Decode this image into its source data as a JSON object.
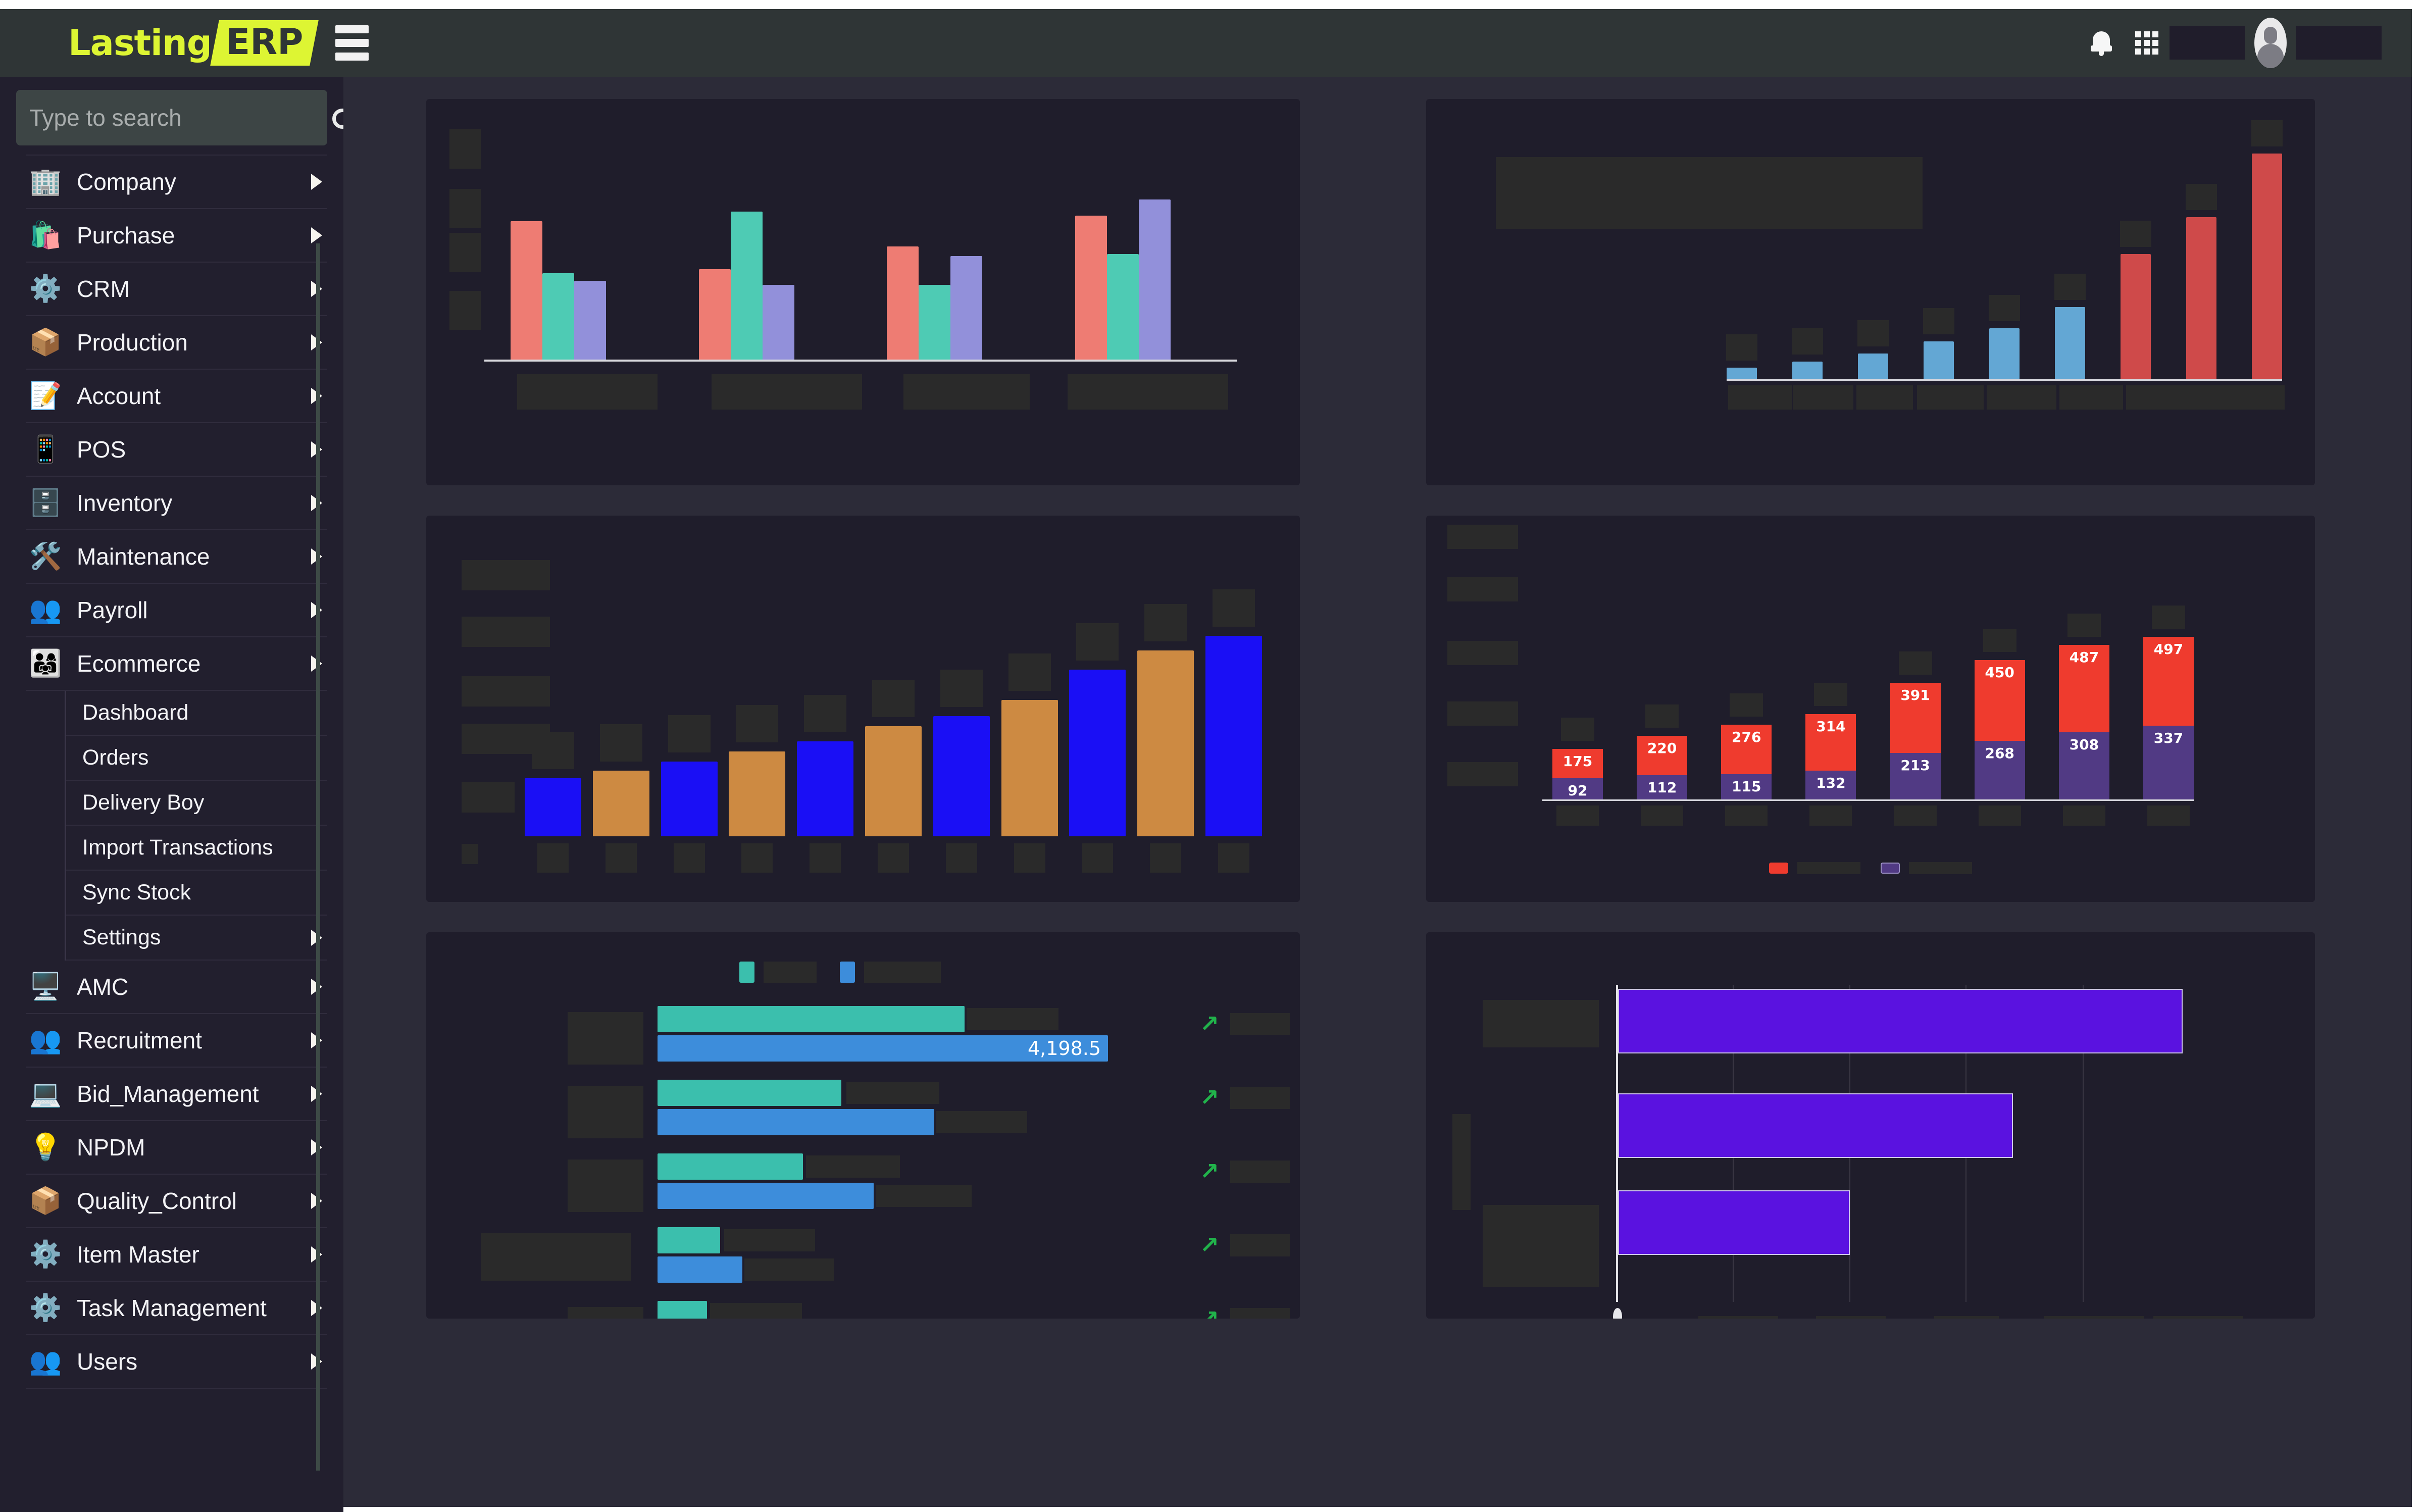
{
  "header": {
    "logo_primary": "Lasting",
    "logo_badge": "ERP",
    "icons": {
      "menu": "hamburger-icon",
      "notifications": "bell-icon",
      "apps": "grid-icon",
      "avatar": "user-avatar"
    }
  },
  "sidebar": {
    "search": {
      "placeholder": "Type to search",
      "value": "",
      "icon": "search-icon"
    },
    "items": [
      {
        "label": "Company",
        "icon": "🏢",
        "expandable": true
      },
      {
        "label": "Purchase",
        "icon": "🛍️",
        "expandable": true
      },
      {
        "label": "CRM",
        "icon": "⚙️",
        "expandable": true
      },
      {
        "label": "Production",
        "icon": "📦",
        "expandable": true
      },
      {
        "label": "Account",
        "icon": "📝",
        "expandable": true
      },
      {
        "label": "POS",
        "icon": "📱",
        "expandable": true
      },
      {
        "label": "Inventory",
        "icon": "🗄️",
        "expandable": true
      },
      {
        "label": "Maintenance",
        "icon": "🛠️",
        "expandable": true
      },
      {
        "label": "Payroll",
        "icon": "👥",
        "expandable": true
      },
      {
        "label": "Ecommerce",
        "icon": "👨‍👩‍👧",
        "expandable": true,
        "expanded": true
      }
    ],
    "ecommerce_submenu": [
      {
        "label": "Dashboard",
        "expandable": false
      },
      {
        "label": "Orders",
        "expandable": false
      },
      {
        "label": "Delivery Boy",
        "expandable": false
      },
      {
        "label": "Import Transactions",
        "expandable": false
      },
      {
        "label": "Sync Stock",
        "expandable": false
      },
      {
        "label": "Settings",
        "expandable": true
      }
    ],
    "items_after": [
      {
        "label": "AMC",
        "icon": "🖥️",
        "expandable": true
      },
      {
        "label": "Recruitment",
        "icon": "👥",
        "expandable": true
      },
      {
        "label": "Bid_Management",
        "icon": "💻",
        "expandable": true
      },
      {
        "label": "NPDM",
        "icon": "💡",
        "expandable": true
      },
      {
        "label": "Quality_Control",
        "icon": "📦",
        "expandable": true
      },
      {
        "label": "Item Master",
        "icon": "⚙️",
        "expandable": true
      },
      {
        "label": "Task Management",
        "icon": "⚙️",
        "expandable": true
      },
      {
        "label": "Users",
        "icon": "👥",
        "expandable": true
      }
    ]
  },
  "colors": {
    "page_bg": "#2c2b38",
    "panel_bg": "#1f1d2b",
    "sidebar_bg": "#221f2e",
    "header_bg": "#2f3536",
    "brand_yellow": "#ddf533",
    "redaction": "#2a2a2a",
    "series_salmon": "#ee7c73",
    "series_teal": "#4ecbb4",
    "series_periwinkle": "#9290da",
    "series_lightblue": "#63a7d4",
    "series_brickred": "#cf4a4a",
    "series_blue": "#1a0ff5",
    "series_orange": "#cd8a42",
    "series_red": "#ef3b2e",
    "series_purple": "#513a84",
    "series_turquoise": "#3bbfad",
    "series_steelblue": "#3d8ddb",
    "series_violet": "#5a12e0",
    "trend_up_green": "#21b24b"
  },
  "chart_data": [
    {
      "id": "grouped-bar-chart",
      "type": "bar",
      "title": "",
      "xlabel": "",
      "ylabel": "",
      "grid": false,
      "legend": "hidden",
      "labels_redacted": true,
      "categories": [
        "",
        "",
        "",
        ""
      ],
      "series": [
        {
          "name": "",
          "color": "#ee7c73",
          "values": [
            72,
            47,
            59,
            75
          ]
        },
        {
          "name": "",
          "color": "#4ecbb4",
          "values": [
            45,
            77,
            39,
            55
          ]
        },
        {
          "name": "",
          "color": "#9290da",
          "values": [
            41,
            43,
            54,
            83
          ]
        }
      ],
      "ylim": [
        0,
        100
      ],
      "ytick_count": 4
    },
    {
      "id": "ascending-bar-chart",
      "type": "bar",
      "title": "",
      "xlabel": "",
      "ylabel": "",
      "grid": false,
      "legend": "hidden",
      "labels_redacted": true,
      "categories": [
        "",
        "",
        "",
        "",
        "",
        "",
        "",
        "",
        ""
      ],
      "values": [
        6,
        10,
        15,
        22,
        30,
        42,
        72,
        94,
        130
      ],
      "bar_colors": [
        "#63a7d4",
        "#63a7d4",
        "#63a7d4",
        "#63a7d4",
        "#63a7d4",
        "#63a7d4",
        "#cf4a4a",
        "#cf4a4a",
        "#cf4a4a"
      ],
      "ylim": [
        0,
        140
      ]
    },
    {
      "id": "alternating-bar-chart",
      "type": "bar",
      "title": "",
      "xlabel": "",
      "ylabel": "",
      "grid": false,
      "legend": "hidden",
      "labels_redacted": true,
      "categories": [
        "",
        "",
        "",
        "",
        "",
        "",
        "",
        "",
        "",
        "",
        ""
      ],
      "values": [
        28,
        32,
        37,
        42,
        48,
        55,
        62,
        70,
        82,
        90,
        98
      ],
      "bar_colors": [
        "#1a0ff5",
        "#cd8a42",
        "#1a0ff5",
        "#cd8a42",
        "#1a0ff5",
        "#cd8a42",
        "#1a0ff5",
        "#cd8a42",
        "#1a0ff5",
        "#cd8a42",
        "#1a0ff5"
      ],
      "ylim": [
        0,
        110
      ],
      "ytick_count": 6
    },
    {
      "id": "stacked-bar-chart",
      "type": "bar",
      "stacked": true,
      "title": "",
      "xlabel": "",
      "ylabel": "",
      "grid": true,
      "legend": "bottom",
      "labels_redacted": true,
      "categories": [
        "",
        "",
        "",
        "",
        "",
        "",
        "",
        ""
      ],
      "series": [
        {
          "name": "",
          "color": "#ef3b2e",
          "values": [
            175,
            220,
            276,
            314,
            391,
            450,
            487,
            497
          ]
        },
        {
          "name": "",
          "color": "#513a84",
          "values": [
            92,
            112,
            115,
            132,
            213,
            268,
            308,
            337
          ]
        }
      ],
      "ylim": [
        0,
        900
      ],
      "ytick_count": 5
    },
    {
      "id": "paired-horizontal-bar-chart",
      "type": "bar",
      "orientation": "horizontal",
      "title": "",
      "xlabel": "",
      "ylabel": "",
      "grid": false,
      "legend": "top",
      "labels_redacted": true,
      "categories": [
        "",
        "",
        "",
        "",
        ""
      ],
      "series": [
        {
          "name": "",
          "color": "#3bbfad",
          "values": [
            4000,
            2100,
            1750,
            720,
            570
          ]
        },
        {
          "name": "",
          "color": "#3d8ddb",
          "values": [
            4198.5,
            2500,
            2050,
            1000,
            850
          ]
        }
      ],
      "value_labels": [
        "4,198.5",
        "",
        "",
        "",
        ""
      ],
      "trend_markers": [
        "↗",
        "↗",
        "↗",
        "↗",
        "↗"
      ]
    },
    {
      "id": "purple-horizontal-bar-chart",
      "type": "bar",
      "orientation": "horizontal",
      "title": "",
      "xlabel": "",
      "ylabel": "",
      "grid": true,
      "legend": "hidden",
      "labels_redacted": true,
      "categories": [
        "",
        "",
        ""
      ],
      "values": [
        98,
        70,
        36
      ],
      "xlim": [
        0,
        110
      ],
      "color": "#5a12e0"
    }
  ]
}
